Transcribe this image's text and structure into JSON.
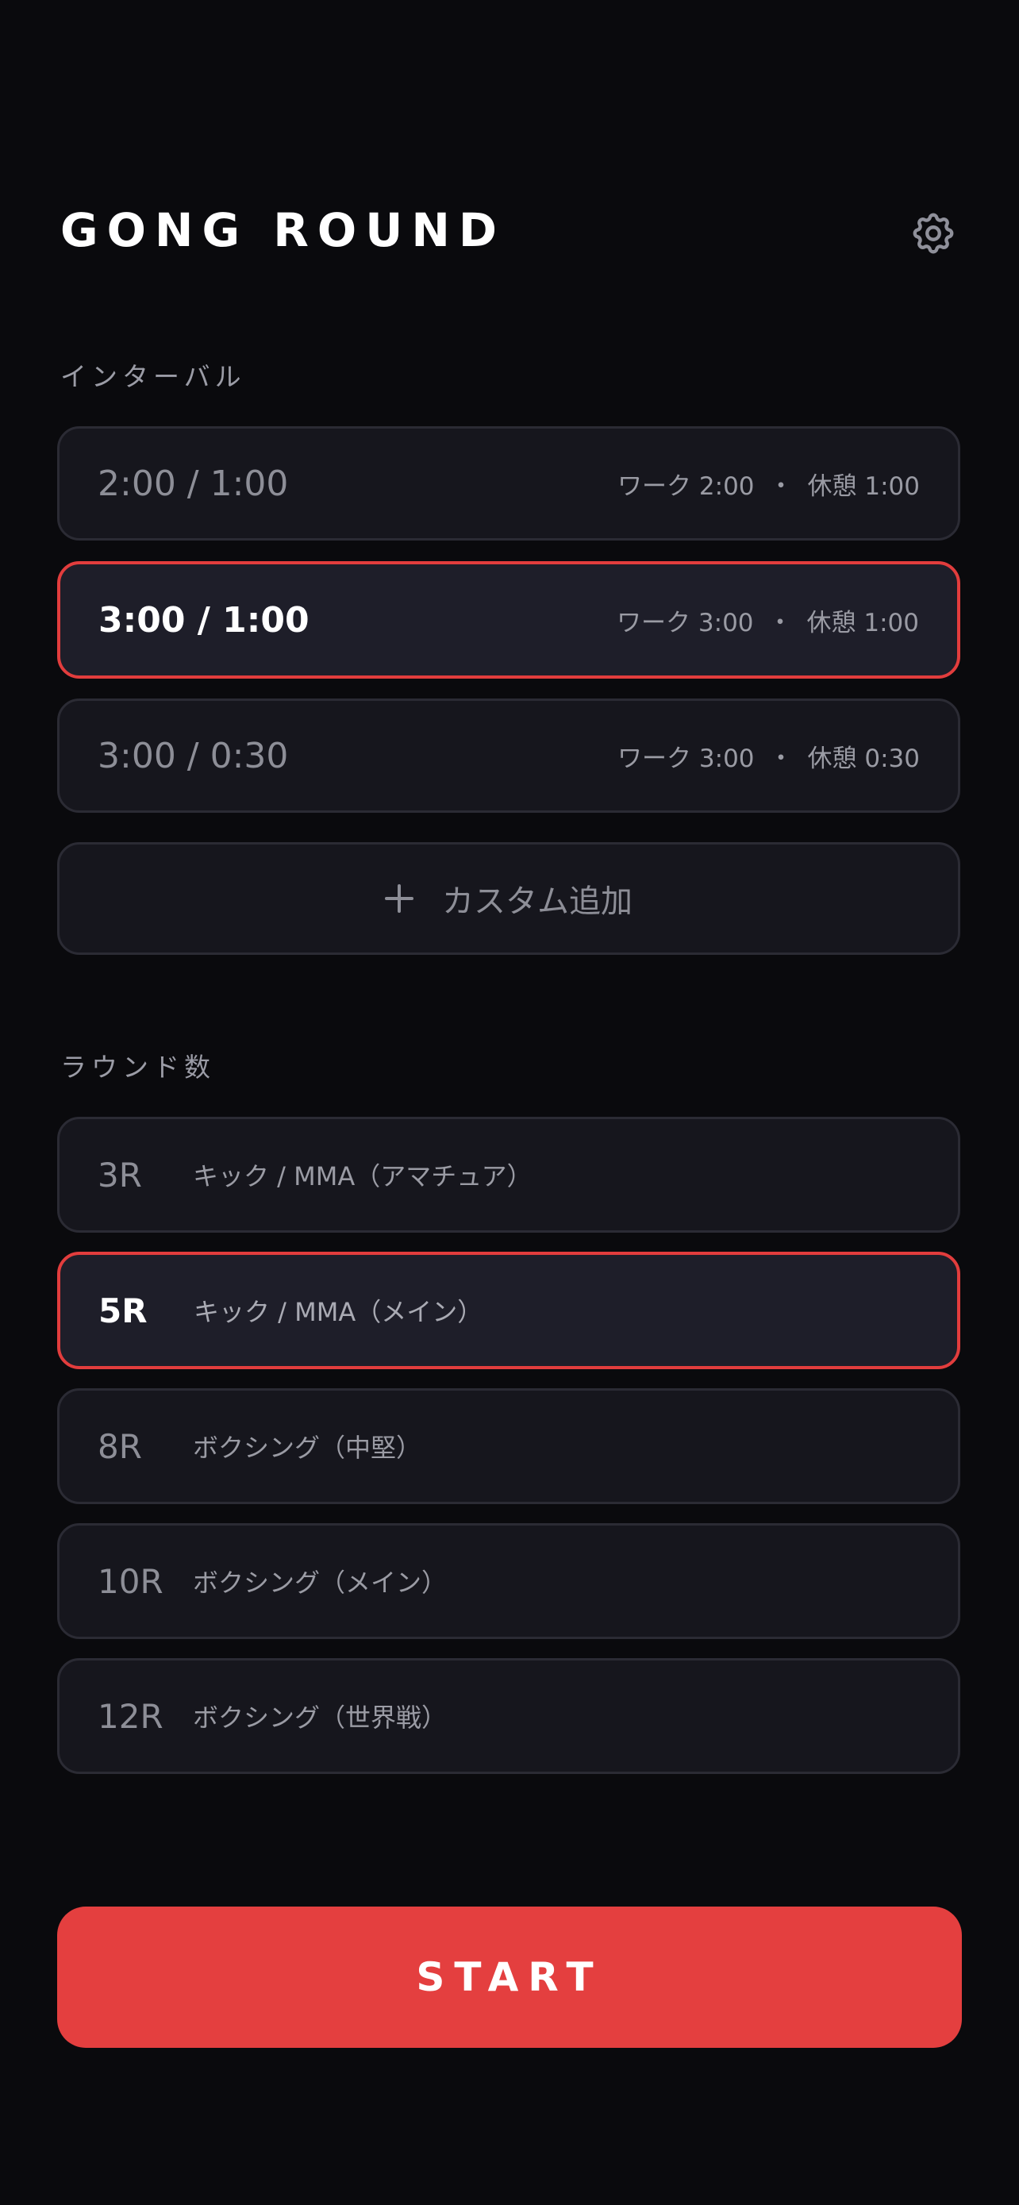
{
  "header": {
    "title": "GONG ROUND",
    "settings_icon": "gear-icon"
  },
  "intervals": {
    "label": "インターバル",
    "items": [
      {
        "main": "2:00 / 1:00",
        "work": "ワーク 2:00",
        "dot": "・",
        "rest": "休憩 1:00",
        "selected": false
      },
      {
        "main": "3:00 / 1:00",
        "work": "ワーク 3:00",
        "dot": "・",
        "rest": "休憩 1:00",
        "selected": true
      },
      {
        "main": "3:00 / 0:30",
        "work": "ワーク 3:00",
        "dot": "・",
        "rest": "休憩 0:30",
        "selected": false
      }
    ],
    "add_label": "カスタム追加",
    "add_icon": "plus-icon"
  },
  "rounds": {
    "label": "ラウンド数",
    "items": [
      {
        "num": "3R",
        "desc": "キック / MMA（アマチュア）",
        "selected": false
      },
      {
        "num": "5R",
        "desc": "キック / MMA（メイン）",
        "selected": true
      },
      {
        "num": "8R",
        "desc": "ボクシング（中堅）",
        "selected": false
      },
      {
        "num": "10R",
        "desc": "ボクシング（メイン）",
        "selected": false
      },
      {
        "num": "12R",
        "desc": "ボクシング（世界戦）",
        "selected": false
      }
    ]
  },
  "start_label": "START",
  "colors": {
    "background": "#0a0a0d",
    "card": "#16161d",
    "accent": "#e43f3f"
  }
}
